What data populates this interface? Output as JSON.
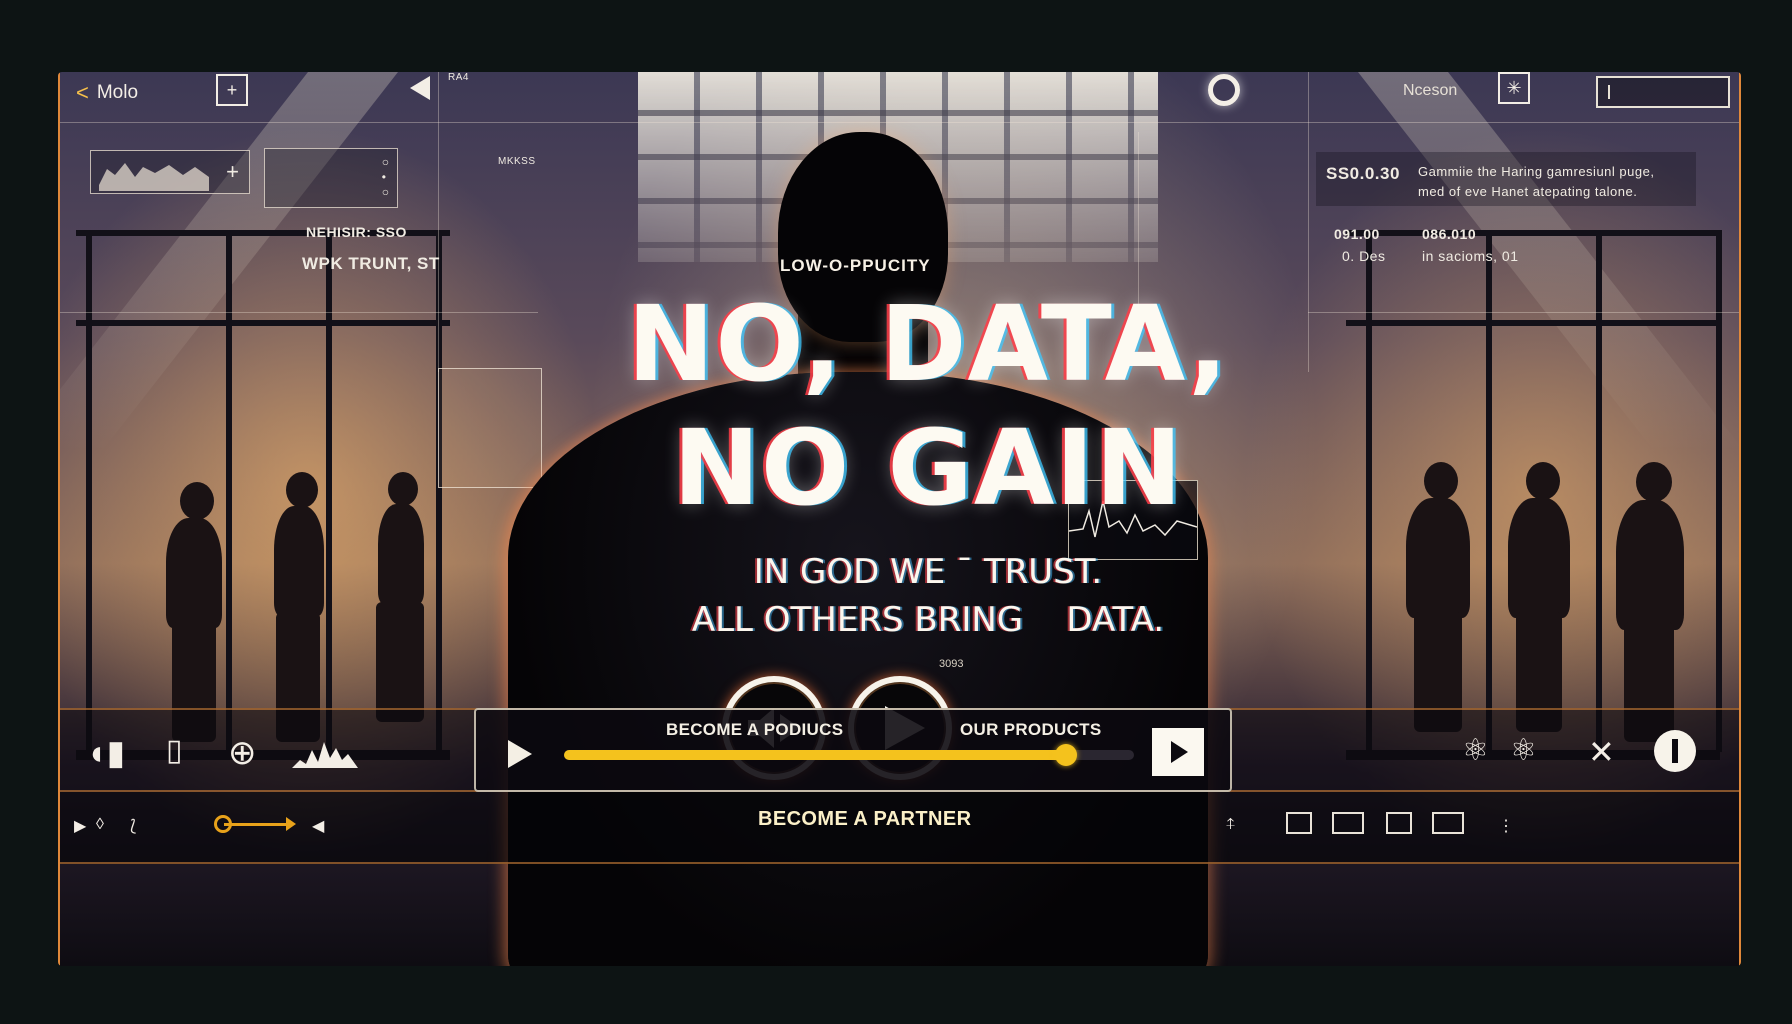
{
  "nav": {
    "back_label": "Molo",
    "name_label": "Nceson",
    "small_tag": "RA4"
  },
  "hud": {
    "mid_label": "MKKSS",
    "left_line1": "NEHISIR:   SSO",
    "left_line2": "WPK TRUNT,  ST",
    "right_value1": "SS0.0.30",
    "right_desc1": "Gammiie the Haring gamresiunl puge,",
    "right_desc2": "med of eve Hanet atepating talone.",
    "right_value2": "091.00",
    "right_value3": "0. Des",
    "right_value4": "086.010",
    "right_value5": "in sacioms, 01"
  },
  "hero": {
    "eyebrow": "LOW-O-PPUCITY",
    "headline_line1": "NO, DATA,",
    "headline_line2": "NO GAIN",
    "tagline_line1": "IN GOD WE ¯ TRUST.",
    "tagline_line2": "ALL OTHERS BRING    DATA.",
    "tiny_mark": "3093"
  },
  "player": {
    "label_left": "BECOME A PODIUCS",
    "label_right": "OUR PRODUCTS",
    "progress": 0.88
  },
  "statusbar": {
    "partner_label": "BECOME A PARTNER"
  },
  "colors": {
    "accent": "#f4c21d",
    "frame_border": "#e0883a"
  }
}
